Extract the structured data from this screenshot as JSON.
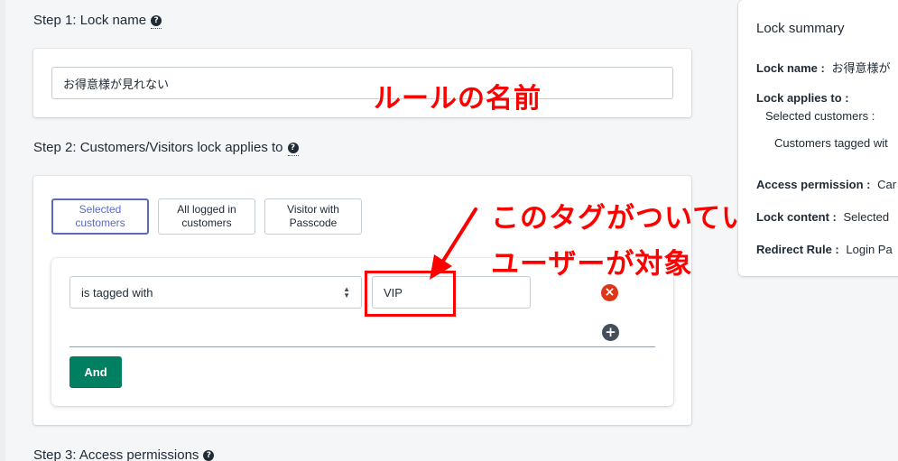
{
  "step1": {
    "title": "Step 1: Lock name",
    "help_glyph": "?",
    "name_value": "お得意様が見れない"
  },
  "step2": {
    "title": "Step 2: Customers/Visitors lock applies to",
    "help_glyph": "?",
    "options": [
      {
        "label": "Selected customers",
        "selected": true
      },
      {
        "label": "All logged in customers",
        "selected": false
      },
      {
        "label": "Visitor with Passcode",
        "selected": false
      }
    ],
    "condition": {
      "operator": "is tagged with",
      "value": "VIP"
    },
    "and_button": "And",
    "remove_glyph": "×",
    "add_glyph": "+"
  },
  "step3": {
    "title": "Step 3: Access permissions",
    "help_glyph": "?"
  },
  "annotations": {
    "rule_name": "ルールの名前",
    "tag_line1": "このタグがついている",
    "tag_line2": "ユーザーが対象"
  },
  "summary": {
    "title": "Lock summary",
    "lock_name_label": "Lock name :",
    "lock_name_value": "お得意様が",
    "applies_label": "Lock applies to :",
    "applies_value": "Selected customers :",
    "applies_detail": "Customers tagged wit",
    "access_label": "Access permission :",
    "access_value": "Car",
    "content_label": "Lock content :",
    "content_value": "Selected",
    "redirect_label": "Redirect Rule :",
    "redirect_value": "Login Pa"
  },
  "colors": {
    "accent": "#5c6ac4",
    "primary_button": "#008060",
    "remove": "#de3618",
    "annotation": "#ff0000"
  }
}
